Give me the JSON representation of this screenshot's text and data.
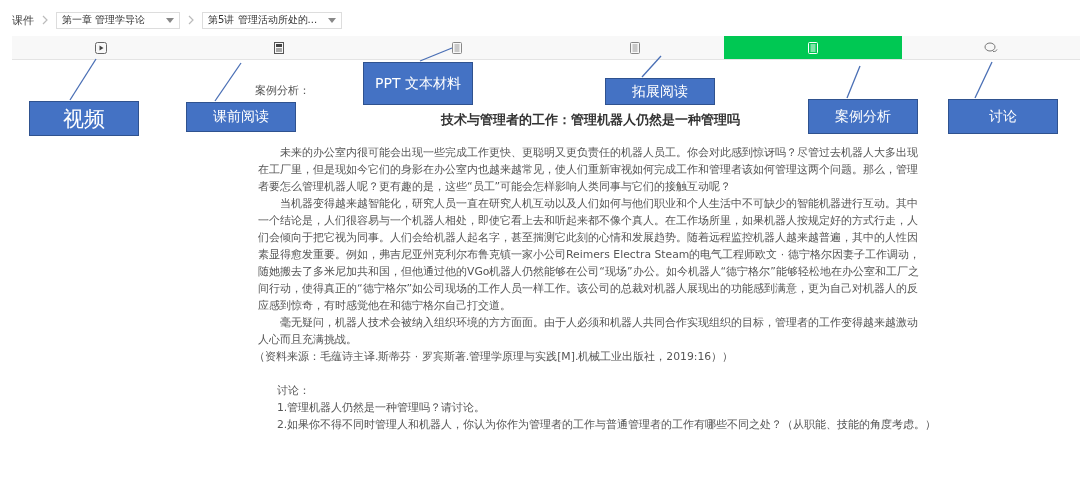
{
  "breadcrumb": {
    "root": "课件",
    "chapter": "第一章 管理学导论",
    "lecture": "第5讲 管理活动所处的..."
  },
  "tabs": [
    {
      "kind": "video",
      "selected": false
    },
    {
      "kind": "reading",
      "selected": false
    },
    {
      "kind": "document",
      "selected": false
    },
    {
      "kind": "document",
      "selected": false
    },
    {
      "kind": "case",
      "selected": true
    },
    {
      "kind": "discussion",
      "selected": false
    }
  ],
  "section_label": "案例分析：",
  "article": {
    "title": "技术与管理者的工作：管理机器人仍然是一种管理吗",
    "paragraphs": [
      "未来的办公室内很可能会出现一些完成工作更快、更聪明又更负责任的机器人员工。你会对此感到惊讶吗？尽管过去机器人大多出现在工厂里，但是现如今它们的身影在办公室内也越来越常见，使人们重新审视如何完成工作和管理者该如何管理这两个问题。那么，管理者要怎么管理机器人呢？更有趣的是，这些“员工”可能会怎样影响人类同事与它们的接触互动呢？",
      "当机器变得越来越智能化，研究人员一直在研究人机互动以及人们如何与他们职业和个人生活中不可缺少的智能机器进行互动。其中一个结论是，人们很容易与一个机器人相处，即使它看上去和听起来都不像个真人。在工作场所里，如果机器人按规定好的方式行走，人们会倾向于把它视为同事。人们会给机器人起名字，甚至揣测它此刻的心情和发展趋势。随着远程监控机器人越来越普遍，其中的人性因素显得愈发重要。例如，弗吉尼亚州克利尔布鲁克镇一家小公司Reimers Electra Steam的电气工程师欧文 · 德宁格尔因妻子工作调动，随她搬去了多米尼加共和国，但他通过他的VGo机器人仍然能够在公司“现场”办公。如今机器人“德宁格尔”能够轻松地在办公室和工厂之间行动，使得真正的“德宁格尔”如公司现场的工作人员一样工作。该公司的总裁对机器人展现出的功能感到满意，更为自己对机器人的反应感到惊奇，有时感觉他在和德宁格尔自己打交道。",
      "毫无疑问，机器人技术会被纳入组织环境的方方面面。由于人必须和机器人共同合作实现组织的目标，管理者的工作变得越来越激动人心而且充满挑战。"
    ],
    "source": "（资料来源：毛蕴诗主译.斯蒂芬 · 罗宾斯著.管理学原理与实践[M].机械工业出版社，2019:16））"
  },
  "discussion": {
    "heading": "讨论：",
    "questions": [
      "1.管理机器人仍然是一种管理吗？请讨论。",
      "2.如果你不得不同时管理人和机器人，你认为你作为管理者的工作与普通管理者的工作有哪些不同之处？（从职能、技能的角度考虑。）"
    ]
  },
  "callouts": [
    {
      "label": "视频"
    },
    {
      "label": "课前阅读"
    },
    {
      "label": "PPT 文本材料"
    },
    {
      "label": "拓展阅读"
    },
    {
      "label": "案例分析"
    },
    {
      "label": "讨论"
    }
  ]
}
